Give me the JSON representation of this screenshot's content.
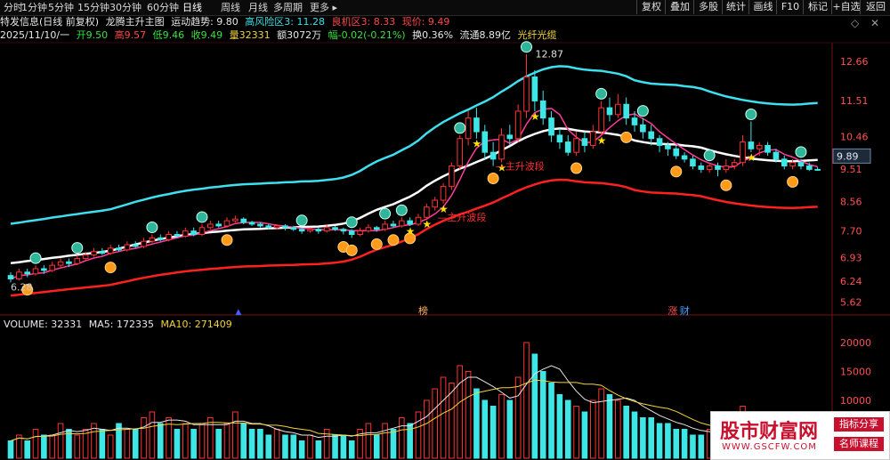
{
  "toolbar": {
    "periods": [
      "分时",
      "1分钟",
      "5分钟",
      "15分钟",
      "30分钟",
      "60分钟",
      "日线",
      "周线",
      "月线",
      "多周期",
      "更多 ▸"
    ],
    "active_period": "日线",
    "right_buttons": [
      "复权",
      "叠加",
      "多股",
      "统计",
      "画线",
      "F10",
      "标记",
      "+自选",
      "返回"
    ]
  },
  "info": {
    "stock_title": "特发信息(日线 前复权)",
    "indicator_name": "龙腾主升主图",
    "trend_label": "运动趋势: 9.80",
    "high_risk": "高风险区3: 11.28",
    "opportunity": "良机区3: 8.33",
    "price_now": "现价: 9.49",
    "date": "2025/11/10/一",
    "open": "开9.50",
    "high": "高9.57",
    "low": "低9.46",
    "close": "收9.49",
    "volume": "量32331",
    "amount": "额3072万",
    "change": "幅-0.02(-0.21%)",
    "turnover": "换0.36%",
    "float_cap": "流通8.89亿",
    "concept": "光纤光缆"
  },
  "price_axis": {
    "labels": [
      "12.66",
      "11.51",
      "10.46",
      "9.51",
      "8.56",
      "7.70",
      "6.93",
      "6.24",
      "5.62"
    ],
    "current_price_tag": "9.89"
  },
  "annotations": {
    "peak_label": "12.87",
    "low_label": "6.28",
    "wave_label_1": "主升波段",
    "wave_label_2": "主升波段",
    "marker_list": "榜",
    "marker_up": "涨",
    "marker_cai": "财"
  },
  "volume_panel": {
    "label": "VOLUME: 32331",
    "ma5": "MA5: 172335",
    "ma10": "MA10: 271409",
    "axis_labels": [
      "20000",
      "15000",
      "10000",
      "5000"
    ]
  },
  "watermark": {
    "title": "股市财富网",
    "url": "WWW.GSCFW.COM",
    "tag1": "指标分享",
    "tag2": "名师课程"
  },
  "colors": {
    "up": "#ff3232",
    "down": "#3ee6e6",
    "upper_band": "#3ee0f0",
    "lower_band": "#ff2020",
    "mid_line": "#ffffff",
    "ma": "#ff3c9c"
  },
  "chart_data": {
    "type": "candlestick",
    "candles": [
      [
        6.4,
        6.3,
        6.5,
        6.2
      ],
      [
        6.3,
        6.5,
        6.6,
        6.25
      ],
      [
        6.5,
        6.45,
        6.6,
        6.35
      ],
      [
        6.45,
        6.6,
        6.7,
        6.4
      ],
      [
        6.6,
        6.55,
        6.7,
        6.45
      ],
      [
        6.55,
        6.7,
        6.8,
        6.5
      ],
      [
        6.7,
        6.8,
        6.9,
        6.6
      ],
      [
        6.8,
        6.75,
        6.9,
        6.65
      ],
      [
        6.75,
        6.9,
        7.0,
        6.7
      ],
      [
        6.9,
        7.0,
        7.1,
        6.85
      ],
      [
        7.0,
        7.1,
        7.2,
        6.95
      ],
      [
        7.1,
        7.05,
        7.2,
        7.0
      ],
      [
        7.05,
        7.2,
        7.3,
        7.0
      ],
      [
        7.2,
        7.15,
        7.3,
        7.1
      ],
      [
        7.15,
        7.3,
        7.4,
        7.1
      ],
      [
        7.3,
        7.25,
        7.4,
        7.2
      ],
      [
        7.25,
        7.4,
        7.5,
        7.2
      ],
      [
        7.4,
        7.5,
        7.6,
        7.35
      ],
      [
        7.5,
        7.45,
        7.6,
        7.4
      ],
      [
        7.45,
        7.6,
        7.7,
        7.4
      ],
      [
        7.6,
        7.55,
        7.7,
        7.5
      ],
      [
        7.55,
        7.7,
        7.8,
        7.5
      ],
      [
        7.7,
        7.6,
        7.8,
        7.55
      ],
      [
        7.6,
        7.8,
        7.9,
        7.55
      ],
      [
        7.8,
        7.9,
        8.0,
        7.75
      ],
      [
        7.9,
        7.85,
        8.0,
        7.8
      ],
      [
        7.85,
        8.0,
        8.1,
        7.8
      ],
      [
        8.0,
        8.05,
        8.15,
        7.95
      ],
      [
        8.05,
        7.95,
        8.1,
        7.9
      ],
      [
        7.95,
        7.9,
        8.0,
        7.85
      ],
      [
        7.9,
        7.85,
        7.95,
        7.8
      ],
      [
        7.85,
        7.8,
        7.9,
        7.75
      ],
      [
        7.8,
        7.85,
        7.9,
        7.75
      ],
      [
        7.85,
        7.8,
        7.9,
        7.72
      ],
      [
        7.8,
        7.75,
        7.85,
        7.7
      ],
      [
        7.75,
        7.7,
        7.8,
        7.62
      ],
      [
        7.7,
        7.75,
        7.8,
        7.65
      ],
      [
        7.75,
        7.7,
        7.8,
        7.62
      ],
      [
        7.7,
        7.8,
        7.9,
        7.65
      ],
      [
        7.8,
        7.75,
        7.85,
        7.7
      ],
      [
        7.75,
        7.7,
        7.8,
        7.6
      ],
      [
        7.7,
        7.6,
        7.75,
        7.5
      ],
      [
        7.6,
        7.7,
        7.8,
        7.55
      ],
      [
        7.7,
        7.8,
        7.9,
        7.65
      ],
      [
        7.8,
        7.75,
        7.85,
        7.68
      ],
      [
        7.75,
        7.9,
        8.0,
        7.7
      ],
      [
        7.9,
        7.85,
        8.0,
        7.8
      ],
      [
        7.85,
        8.0,
        8.1,
        7.8
      ],
      [
        8.0,
        7.9,
        8.1,
        7.85
      ],
      [
        7.9,
        8.1,
        8.2,
        7.85
      ],
      [
        8.1,
        8.4,
        8.5,
        8.05
      ],
      [
        8.4,
        8.6,
        8.7,
        8.3
      ],
      [
        8.6,
        9.0,
        9.1,
        8.5
      ],
      [
        9.0,
        9.6,
        9.7,
        8.9
      ],
      [
        9.6,
        10.4,
        10.5,
        9.5
      ],
      [
        10.4,
        11.0,
        11.2,
        10.2
      ],
      [
        11.0,
        10.6,
        11.3,
        10.4
      ],
      [
        10.6,
        10.0,
        10.8,
        9.8
      ],
      [
        10.0,
        9.8,
        10.3,
        9.6
      ],
      [
        9.8,
        10.5,
        10.7,
        9.7
      ],
      [
        10.5,
        10.4,
        10.8,
        10.2
      ],
      [
        10.4,
        11.2,
        11.4,
        10.3
      ],
      [
        11.2,
        12.2,
        12.87,
        11.0
      ],
      [
        12.2,
        11.5,
        12.4,
        11.2
      ],
      [
        11.5,
        11.0,
        11.8,
        10.8
      ],
      [
        11.0,
        10.5,
        11.2,
        10.3
      ],
      [
        10.5,
        10.3,
        10.7,
        10.1
      ],
      [
        10.3,
        10.0,
        10.5,
        9.9
      ],
      [
        10.0,
        10.4,
        10.6,
        9.9
      ],
      [
        10.4,
        10.2,
        10.6,
        10.0
      ],
      [
        10.2,
        10.6,
        10.8,
        10.1
      ],
      [
        10.6,
        11.3,
        11.5,
        10.5
      ],
      [
        11.3,
        11.1,
        11.6,
        10.9
      ],
      [
        11.1,
        11.4,
        11.7,
        11.0
      ],
      [
        11.4,
        11.0,
        11.6,
        10.8
      ],
      [
        11.0,
        10.8,
        11.2,
        10.6
      ],
      [
        10.8,
        10.6,
        11.0,
        10.4
      ],
      [
        10.6,
        10.4,
        10.8,
        10.2
      ],
      [
        10.4,
        10.2,
        10.5,
        10.0
      ],
      [
        10.2,
        10.1,
        10.3,
        9.9
      ],
      [
        10.1,
        9.9,
        10.2,
        9.8
      ],
      [
        9.9,
        9.8,
        10.0,
        9.7
      ],
      [
        9.8,
        9.6,
        9.9,
        9.5
      ],
      [
        9.6,
        9.5,
        9.7,
        9.4
      ],
      [
        9.5,
        9.6,
        9.7,
        9.4
      ],
      [
        9.6,
        9.5,
        9.7,
        9.3
      ],
      [
        9.5,
        9.6,
        9.8,
        9.4
      ],
      [
        9.6,
        9.7,
        9.8,
        9.5
      ],
      [
        9.7,
        10.3,
        10.5,
        9.6
      ],
      [
        10.3,
        10.1,
        10.9,
        10.0
      ],
      [
        10.1,
        10.2,
        10.3,
        9.9
      ],
      [
        10.2,
        10.0,
        10.3,
        9.9
      ],
      [
        10.0,
        9.8,
        10.1,
        9.7
      ],
      [
        9.8,
        9.6,
        9.9,
        9.5
      ],
      [
        9.6,
        9.7,
        9.8,
        9.5
      ],
      [
        9.7,
        9.6,
        9.8,
        9.5
      ],
      [
        9.6,
        9.5,
        9.7,
        9.45
      ],
      [
        9.5,
        9.49,
        9.57,
        9.46
      ]
    ],
    "volume": [
      3,
      4,
      3,
      5,
      4,
      4,
      6,
      5,
      4,
      5,
      6,
      5,
      4,
      6,
      5,
      5,
      7,
      8,
      6,
      7,
      5,
      6,
      5,
      6,
      7,
      5,
      6,
      8,
      6,
      5,
      5,
      4,
      5,
      4,
      4,
      3,
      4,
      3,
      5,
      4,
      4,
      3,
      5,
      6,
      4,
      6,
      5,
      7,
      6,
      8,
      10,
      12,
      14,
      13,
      16,
      15,
      12,
      10,
      9,
      11,
      10,
      14,
      20,
      18,
      15,
      13,
      11,
      10,
      9,
      8,
      10,
      12,
      11,
      10,
      9,
      8,
      7,
      7,
      6,
      6,
      5,
      5,
      4,
      4,
      5,
      4,
      5,
      5,
      9,
      8,
      6,
      5,
      4,
      4,
      3,
      3,
      3,
      3
    ],
    "ma5_series": [
      5,
      5.1,
      5.2,
      5.4,
      5.6
    ],
    "ylim": [
      5.3,
      13.2
    ],
    "y_ticks": [
      12.66,
      11.51,
      10.46,
      9.51,
      8.56,
      7.7,
      6.93,
      6.24,
      5.62
    ]
  }
}
